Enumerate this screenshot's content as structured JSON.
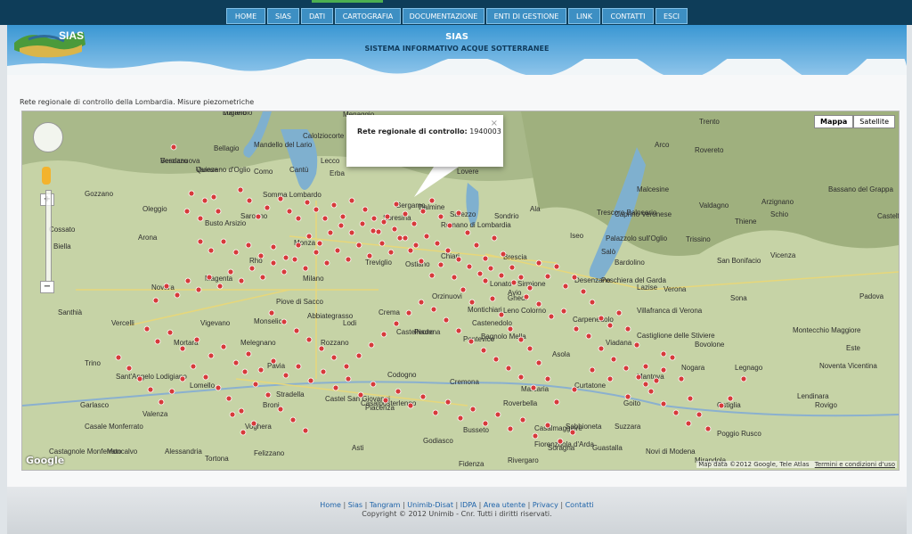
{
  "nav": {
    "items": [
      "HOME",
      "SIAS",
      "DATI",
      "CARTOGRAFIA",
      "DOCUMENTAZIONE",
      "ENTI DI GESTIONE",
      "LINK",
      "CONTATTI",
      "ESCI"
    ]
  },
  "header": {
    "logo_text": "SIAS",
    "title": "SIAS",
    "subtitle": "SISTEMA INFORMATIVO ACQUE SOTTERRANEE"
  },
  "page": {
    "caption": "Rete regionale di controllo della Lombardia. Misure piezometriche"
  },
  "map": {
    "type_buttons": [
      "Mappa",
      "Satellite"
    ],
    "popup": {
      "label": "Rete regionale di controllo:",
      "value": "1940003"
    },
    "attribution": "Map data ©2012 Google, Tele Atlas",
    "terms": "Termini e condizioni d'uso",
    "google": "Google",
    "places": [
      "Lugano",
      "Besozzo",
      "Varese",
      "Como",
      "Lecco",
      "Bergamo",
      "Lovere",
      "Saronno",
      "Monza",
      "Busto Arsizio",
      "Rho",
      "Milano",
      "Magenta",
      "Novara",
      "Vercelli",
      "Vigevano",
      "Pavia",
      "Lodi",
      "Crema",
      "Treviglio",
      "Brescia",
      "Chiari",
      "Orzinuovi",
      "Cremona",
      "Piacenza",
      "Codogno",
      "Casalpusterlengo",
      "Voghera",
      "Alessandria",
      "Tortona",
      "Mantova",
      "Sabbioneta",
      "Verona",
      "Vicenza",
      "Padova",
      "Rovigo",
      "Legnago",
      "Peschiera del Garda",
      "Malcesine",
      "Arco",
      "Rovereto",
      "Trento",
      "Bassano del Grappa",
      "Castelfranco Veneto",
      "Ostiglia",
      "Suzzara",
      "Guastalla",
      "Novi di Modena",
      "Fidenza",
      "Busseto",
      "Casalmaggiore",
      "Asola",
      "Castel San Giovanni",
      "Broni",
      "Castelleone",
      "Pontevico",
      "Leno",
      "Ghedi",
      "Desenzano",
      "Villafranca di Verona",
      "Bovolone",
      "Nogara",
      "Lendinara",
      "Mirandola",
      "Poggio Rusco",
      "Stradella",
      "Valenza",
      "Mortara",
      "Lomello",
      "Trino",
      "Santhià",
      "Biella",
      "Cossato",
      "Gozzano",
      "Arona",
      "Oleggio",
      "Somma Lombardo",
      "Cantù",
      "Erba",
      "Calolziocorte",
      "Mandello del Lario",
      "Bellagio",
      "Menaggio",
      "Sondrio",
      "Sarezzo",
      "Iseo",
      "Salò",
      "Bardolino",
      "Lazise",
      "Sona",
      "San Bonifacio",
      "Arzignano",
      "Schio",
      "Thiene",
      "Valdagno",
      "Trissino",
      "Montecchio Maggiore",
      "Noventa Vicentina",
      "Este",
      "Monselice",
      "Piove di Sacco",
      "Abbiategrasso",
      "Rozzano",
      "Melegnano",
      "Sant'Angelo Lodigiano",
      "Garlasco",
      "Casale Monferrato",
      "Moncalvo",
      "Castagnole Monferrato",
      "Felizzano",
      "Asti",
      "Godiasco",
      "Rivergaro",
      "Fiorenzuola d'Arda",
      "Soragna",
      "Colorno",
      "Viadana",
      "Carpenedolo",
      "Goito",
      "Castiglione delle Stiviere",
      "Curtatone",
      "Roverbella",
      "Marcaria",
      "Piadena",
      "Ostiano",
      "Soresina",
      "Romano di Lombardia",
      "Dalmine",
      "Palazzolo sull'Oglio",
      "Trescore Balneario",
      "Caprino Veronese",
      "Ala",
      "Avio",
      "Sirmione",
      "Lonato",
      "Montichiari",
      "Castenedolo",
      "Bagnolo Mella",
      "Manerbio",
      "Verolanuova",
      "Quinzano d'Oglio"
    ]
  },
  "markers": {
    "color": "#d63a3a",
    "count_description": "Measurement stations of the regional groundwater monitoring network"
  },
  "footer": {
    "links": [
      "Home",
      "Sias",
      "Tangram",
      "Unimib-Disat",
      "IDPA",
      "Area utente",
      "Privacy",
      "Contatti"
    ],
    "copyright": "Copyright © 2012 Unimib - Cnr. Tutti i diritti riservati."
  }
}
